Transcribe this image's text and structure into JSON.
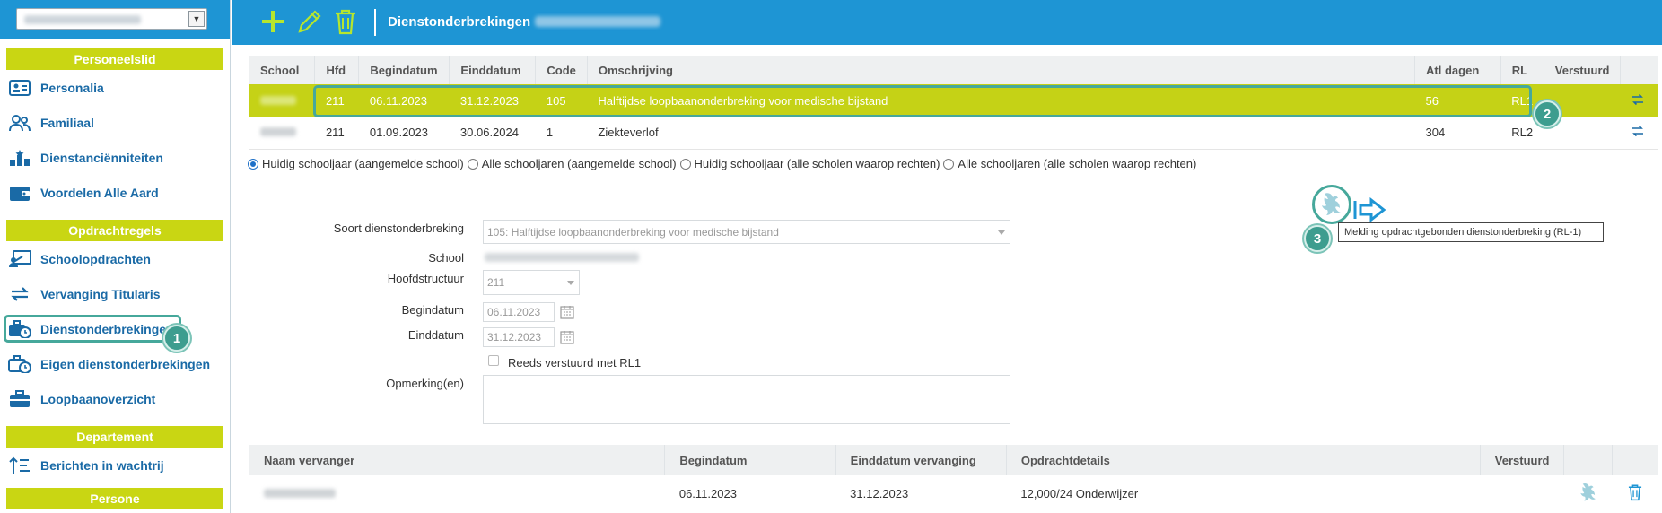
{
  "sidebar": {
    "sections": [
      {
        "header": "Personeelslid",
        "items": [
          "Personalia",
          "Familiaal",
          "Dienstanciënniteiten",
          "Voordelen Alle Aard"
        ]
      },
      {
        "header": "Opdrachtregels",
        "items": [
          "Schoolopdrachten",
          "Vervanging Titularis",
          "Dienstonderbrekingen",
          "Eigen dienstonderbrekingen",
          "Loopbaanoverzicht"
        ]
      },
      {
        "header": "Departement",
        "items": [
          "Berichten in wachtrij"
        ]
      },
      {
        "header": "Persone"
      }
    ],
    "active_item": "Dienstonderbrekingen"
  },
  "toolbar": {
    "title": "Dienstonderbrekingen"
  },
  "grid": {
    "columns": [
      "School",
      "Hfd",
      "Begindatum",
      "Einddatum",
      "Code",
      "Omschrijving",
      "Atl dagen",
      "RL",
      "Verstuurd"
    ],
    "rows": [
      {
        "hfd": "211",
        "begin": "06.11.2023",
        "eind": "31.12.2023",
        "code": "105",
        "omschrijving": "Halftijdse loopbaanonderbreking voor medische bijstand",
        "atl": "56",
        "rl": "RL1",
        "selected": true
      },
      {
        "hfd": "211",
        "begin": "01.09.2023",
        "eind": "30.06.2024",
        "code": "1",
        "omschrijving": "Ziekteverlof",
        "atl": "304",
        "rl": "RL2",
        "selected": false
      }
    ]
  },
  "filters": {
    "options": [
      "Huidig schooljaar (aangemelde school)",
      "Alle schooljaren (aangemelde school)",
      "Huidig schooljaar (alle scholen waarop rechten)",
      "Alle schooljaren (alle scholen waarop rechten)"
    ],
    "selected": 0
  },
  "form": {
    "soort_label": "Soort dienstonderbreking",
    "soort_value": "105: Halftijdse loopbaanonderbreking voor medische bijstand",
    "school_label": "School",
    "hoofd_label": "Hoofdstructuur",
    "hoofd_value": "211",
    "begin_label": "Begindatum",
    "begin_value": "06.11.2023",
    "eind_label": "Einddatum",
    "eind_value": "31.12.2023",
    "reeds_label": "Reeds verstuurd met RL1",
    "opm_label": "Opmerking(en)"
  },
  "tooltip": "Melding opdrachtgebonden dienstonderbreking (RL-1)",
  "callouts": [
    "1",
    "2",
    "3"
  ],
  "grid2": {
    "columns": [
      "Naam vervanger",
      "Begindatum",
      "Einddatum vervanging",
      "Opdrachtdetails",
      "Verstuurd"
    ],
    "rows": [
      {
        "begin": "06.11.2023",
        "eind": "31.12.2023",
        "details": "12,000/24 Onderwijzer"
      }
    ]
  },
  "colors": {
    "brand_blue": "#1e95d4",
    "accent_lime": "#c9d613",
    "callout_teal": "#3d9d8f",
    "link_blue": "#1a6aa6"
  }
}
